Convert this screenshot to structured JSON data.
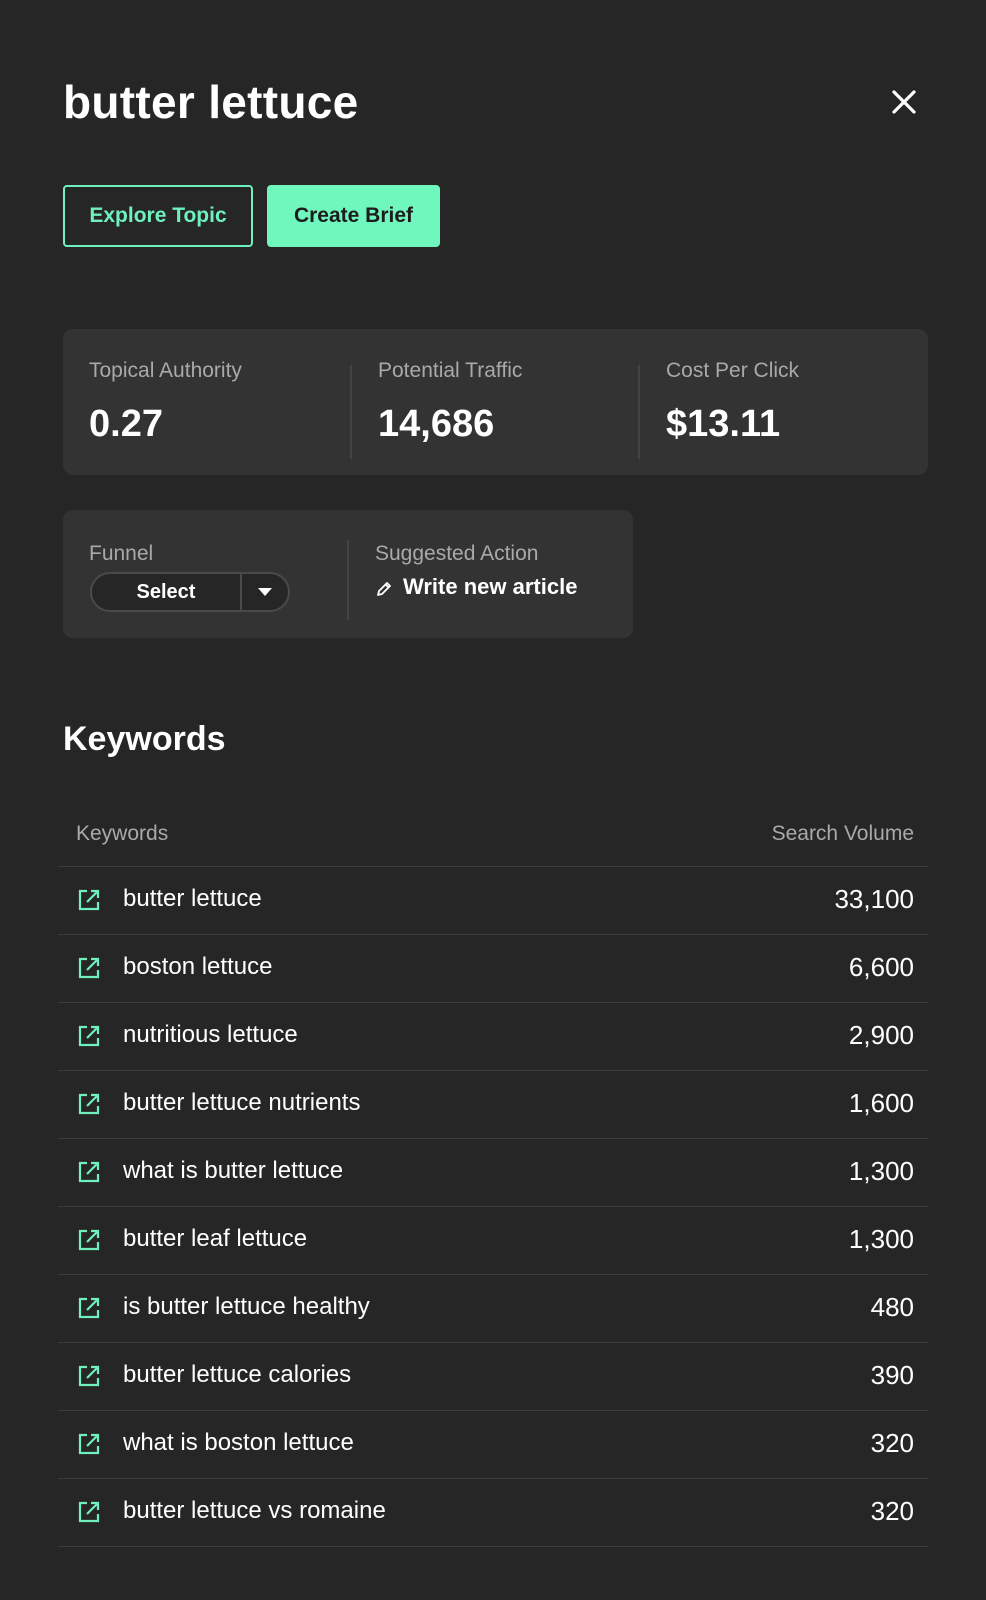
{
  "header": {
    "title": "butter lettuce",
    "close_icon": "close-icon"
  },
  "actions": {
    "explore_label": "Explore Topic",
    "brief_label": "Create Brief"
  },
  "stats": [
    {
      "label": "Topical Authority",
      "value": "0.27"
    },
    {
      "label": "Potential Traffic",
      "value": "14,686"
    },
    {
      "label": "Cost Per Click",
      "value": "$13.11"
    }
  ],
  "funnel": {
    "label": "Funnel",
    "selected": "Select"
  },
  "suggested": {
    "label": "Suggested Action",
    "action": "Write new article",
    "icon": "pencil-icon"
  },
  "keywords": {
    "title": "Keywords",
    "columns": {
      "keyword": "Keywords",
      "volume": "Search Volume"
    },
    "rows": [
      {
        "keyword": "butter lettuce",
        "volume": "33,100"
      },
      {
        "keyword": "boston lettuce",
        "volume": "6,600"
      },
      {
        "keyword": "nutritious lettuce",
        "volume": "2,900"
      },
      {
        "keyword": "butter lettuce nutrients",
        "volume": "1,600"
      },
      {
        "keyword": "what is butter lettuce",
        "volume": "1,300"
      },
      {
        "keyword": "butter leaf lettuce",
        "volume": "1,300"
      },
      {
        "keyword": "is butter lettuce healthy",
        "volume": "480"
      },
      {
        "keyword": "butter lettuce calories",
        "volume": "390"
      },
      {
        "keyword": "what is boston lettuce",
        "volume": "320"
      },
      {
        "keyword": "butter lettuce vs romaine",
        "volume": "320"
      }
    ],
    "row_icon": "external-link-icon"
  },
  "colors": {
    "background": "#262626",
    "card": "#333333",
    "accent": "#6ff7bd",
    "muted_text": "#a9a9a9"
  }
}
